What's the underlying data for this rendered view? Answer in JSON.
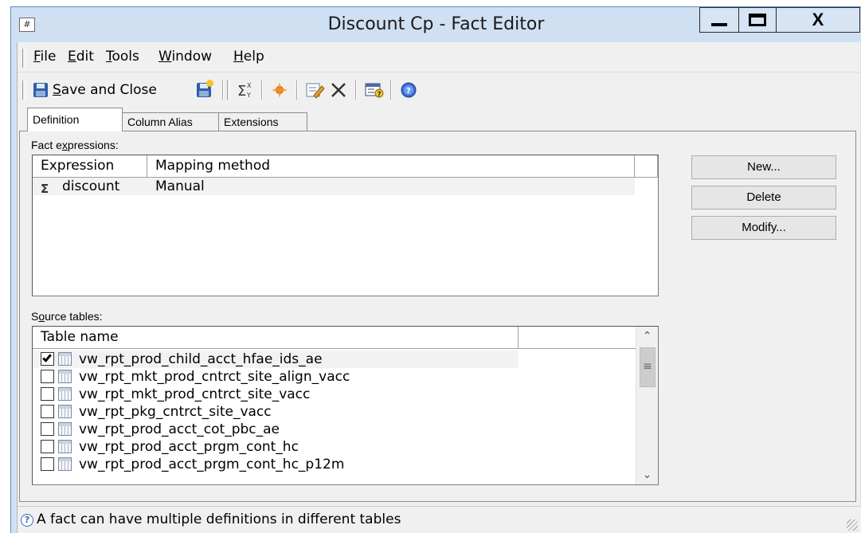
{
  "window": {
    "title": "Discount Cp - Fact Editor",
    "app_icon": "grid-app-icon",
    "controls": {
      "minimize": "minimize-icon",
      "maximize": "maximize-icon",
      "close": "X"
    }
  },
  "menu": [
    {
      "label": "File",
      "underline": "F",
      "rest": "ile"
    },
    {
      "label": "Edit",
      "underline": "E",
      "rest": "dit"
    },
    {
      "label": "Tools",
      "underline": "T",
      "rest": "ools"
    },
    {
      "label": "Window",
      "underline": "W",
      "rest": "indow"
    },
    {
      "label": "Help",
      "underline": "H",
      "rest": "elp"
    }
  ],
  "toolbar": {
    "save_and_close": {
      "underline": "S",
      "rest": "ave and Close"
    },
    "icons": [
      "save-icon",
      "save-new-icon",
      "sigma-expression-icon",
      "sparkle-icon",
      "edit-icon",
      "delete-icon",
      "properties-icon",
      "help-icon"
    ]
  },
  "tabs": [
    {
      "label": "Definition",
      "active": true
    },
    {
      "label": "Column Alias",
      "active": false
    },
    {
      "label": "Extensions",
      "active": false
    }
  ],
  "fact_expressions": {
    "label_pre": "Fact e",
    "label_u": "x",
    "label_post": "pressions:",
    "columns": [
      "Expression",
      "Mapping method"
    ],
    "rows": [
      {
        "expression": "discount",
        "mapping": "Manual"
      }
    ]
  },
  "buttons": {
    "new": "New...",
    "delete": "Delete",
    "modify": "Modify..."
  },
  "source_tables": {
    "label_pre": "S",
    "label_u": "o",
    "label_post": "urce tables:",
    "column": "Table name",
    "rows": [
      {
        "name": "vw_rpt_prod_child_acct_hfae_ids_ae",
        "checked": true
      },
      {
        "name": "vw_rpt_mkt_prod_cntrct_site_align_vacc",
        "checked": false
      },
      {
        "name": "vw_rpt_mkt_prod_cntrct_site_vacc",
        "checked": false
      },
      {
        "name": "vw_rpt_pkg_cntrct_site_vacc",
        "checked": false
      },
      {
        "name": "vw_rpt_prod_acct_cot_pbc_ae",
        "checked": false
      },
      {
        "name": "vw_rpt_prod_acct_prgm_cont_hc",
        "checked": false
      },
      {
        "name": "vw_rpt_prod_acct_prgm_cont_hc_p12m",
        "checked": false
      }
    ]
  },
  "status": {
    "text": "A fact can have multiple definitions in different tables"
  }
}
